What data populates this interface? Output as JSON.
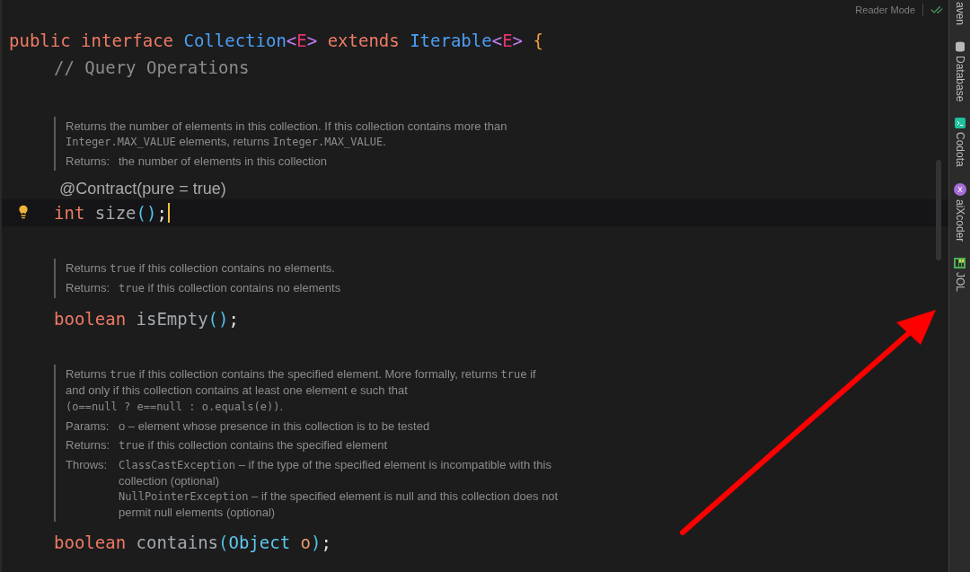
{
  "reader_mode": {
    "label": "Reader Mode"
  },
  "header": [
    {
      "kind": "keyword",
      "text": "public interface "
    },
    {
      "kind": "type",
      "text": "Collection"
    },
    {
      "kind": "angle",
      "text": "<"
    },
    {
      "kind": "typeparam",
      "text": "E"
    },
    {
      "kind": "angle",
      "text": ">"
    },
    {
      "kind": "keyword",
      "text": " extends "
    },
    {
      "kind": "type",
      "text": "Iterable"
    },
    {
      "kind": "angle",
      "text": "<"
    },
    {
      "kind": "typeparam",
      "text": "E"
    },
    {
      "kind": "angle",
      "text": ">"
    },
    {
      "kind": "brace",
      "text": " {"
    }
  ],
  "comment": "// Query Operations",
  "members": [
    {
      "doc": [
        {
          "kind": "para",
          "lines": [
            [
              {
                "kind": "text",
                "text": "Returns the number of elements in this collection. If this collection contains more than"
              }
            ],
            [
              {
                "kind": "code",
                "text": "Integer.MAX_VALUE"
              },
              {
                "kind": "text",
                "text": " elements, returns "
              },
              {
                "kind": "code",
                "text": "Integer.MAX_VALUE"
              },
              {
                "kind": "text",
                "text": "."
              }
            ]
          ]
        },
        {
          "kind": "tag",
          "tag": "Returns:",
          "lines": [
            [
              {
                "kind": "text",
                "text": "the number of elements in this collection"
              }
            ]
          ]
        }
      ],
      "annotation": "@Contract(pure = true)",
      "current": true,
      "signature": [
        {
          "kind": "keyword",
          "text": "int "
        },
        {
          "kind": "plain",
          "text": "size"
        },
        {
          "kind": "paren",
          "text": "()"
        },
        {
          "kind": "punct",
          "text": ";"
        }
      ]
    },
    {
      "doc": [
        {
          "kind": "para",
          "lines": [
            [
              {
                "kind": "text",
                "text": "Returns "
              },
              {
                "kind": "code",
                "text": "true"
              },
              {
                "kind": "text",
                "text": " if this collection contains no elements."
              }
            ]
          ]
        },
        {
          "kind": "tag",
          "tag": "Returns:",
          "lines": [
            [
              {
                "kind": "code",
                "text": "true"
              },
              {
                "kind": "text",
                "text": " if this collection contains no elements"
              }
            ]
          ]
        }
      ],
      "current": false,
      "signature": [
        {
          "kind": "keyword",
          "text": "boolean "
        },
        {
          "kind": "plain",
          "text": "isEmpty"
        },
        {
          "kind": "paren",
          "text": "()"
        },
        {
          "kind": "punct",
          "text": ";"
        }
      ]
    },
    {
      "doc": [
        {
          "kind": "para",
          "lines": [
            [
              {
                "kind": "text",
                "text": "Returns "
              },
              {
                "kind": "code",
                "text": "true"
              },
              {
                "kind": "text",
                "text": " if this collection contains the specified element. More formally, returns "
              },
              {
                "kind": "code",
                "text": "true"
              },
              {
                "kind": "text",
                "text": " if"
              }
            ],
            [
              {
                "kind": "text",
                "text": "and only if this collection contains at least one element "
              },
              {
                "kind": "code",
                "text": "e"
              },
              {
                "kind": "text",
                "text": " such that"
              }
            ],
            [
              {
                "kind": "code",
                "text": "(o==null ? e==null : o.equals(e))"
              },
              {
                "kind": "text",
                "text": "."
              }
            ]
          ]
        },
        {
          "kind": "tag",
          "tag": "Params:",
          "lines": [
            [
              {
                "kind": "text",
                "text": "o – element whose presence in this collection is to be tested"
              }
            ]
          ]
        },
        {
          "kind": "tag",
          "tag": "Returns:",
          "lines": [
            [
              {
                "kind": "code",
                "text": "true"
              },
              {
                "kind": "text",
                "text": " if this collection contains the specified element"
              }
            ]
          ]
        },
        {
          "kind": "tag",
          "tag": "Throws:",
          "lines": [
            [
              {
                "kind": "code",
                "text": "ClassCastException"
              },
              {
                "kind": "text",
                "text": " – if the type of the specified element is incompatible with this"
              }
            ],
            [
              {
                "kind": "text",
                "text": "collection (optional)"
              }
            ],
            [
              {
                "kind": "code",
                "text": "NullPointerException"
              },
              {
                "kind": "text",
                "text": " – if the specified element is null and this collection does not"
              }
            ],
            [
              {
                "kind": "text",
                "text": "permit null elements (optional)"
              }
            ]
          ]
        }
      ],
      "current": false,
      "signature": [
        {
          "kind": "keyword",
          "text": "boolean "
        },
        {
          "kind": "plain",
          "text": "contains"
        },
        {
          "kind": "paren",
          "text": "("
        },
        {
          "kind": "type2",
          "text": "Object "
        },
        {
          "kind": "param",
          "text": "o"
        },
        {
          "kind": "paren",
          "text": ")"
        },
        {
          "kind": "punct",
          "text": ";"
        }
      ]
    }
  ],
  "tool_strip": [
    {
      "label": "aven",
      "kind": "plain"
    },
    {
      "label": "Database",
      "kind": "database"
    },
    {
      "label": "Codota",
      "kind": "codota"
    },
    {
      "label": "aiXcoder",
      "kind": "aixcoder"
    },
    {
      "label": "JOL",
      "kind": "jol"
    }
  ]
}
